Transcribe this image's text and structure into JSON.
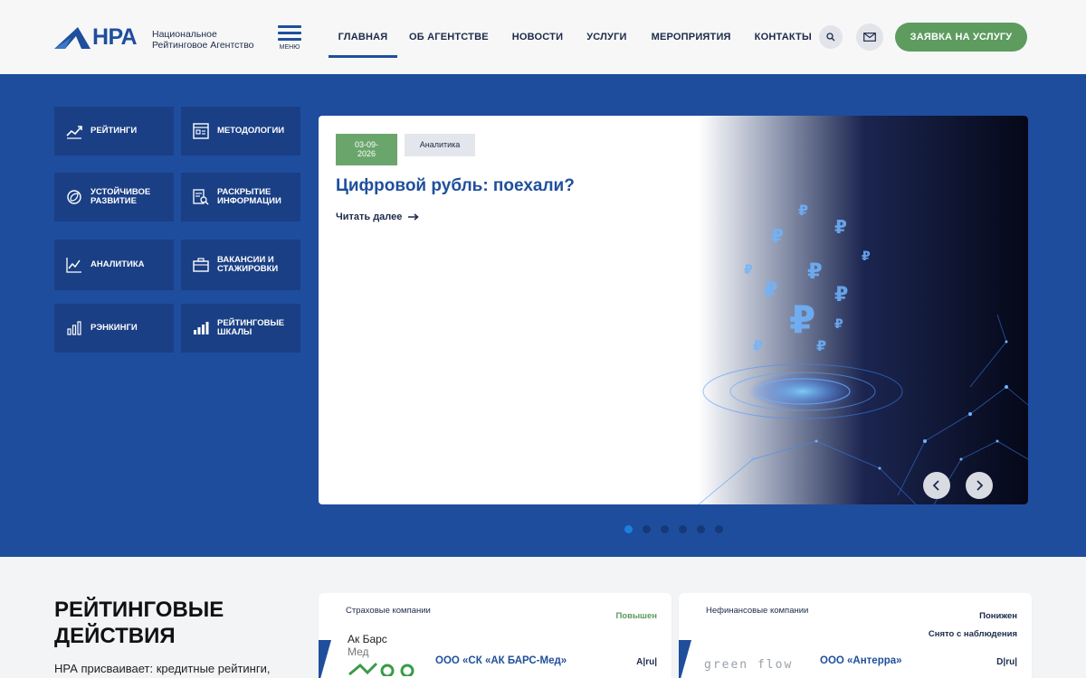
{
  "header": {
    "logo_text": "НРА",
    "logo_sub_line1": "Национальное",
    "logo_sub_line2": "Рейтинговое Агентство",
    "menu_label": "МЕНЮ",
    "nav": [
      {
        "label": "ГЛАВНАЯ",
        "active": true
      },
      {
        "label": "ОБ АГЕНТСТВЕ",
        "active": false
      },
      {
        "label": "НОВОСТИ",
        "active": false
      },
      {
        "label": "УСЛУГИ",
        "active": false
      },
      {
        "label": "МЕРОПРИЯТИЯ",
        "active": false
      },
      {
        "label": "КОНТАКТЫ",
        "active": false
      }
    ],
    "search_icon": "search-icon",
    "mail_icon": "mail-icon",
    "cta_label": "ЗАЯВКА НА УСЛУГУ"
  },
  "tiles": [
    {
      "line1": "РЕЙТИНГИ",
      "line2": "",
      "icon": "chart-up-icon"
    },
    {
      "line1": "МЕТОДОЛОГИИ",
      "line2": "",
      "icon": "methodology-icon"
    },
    {
      "line1": "УСТОЙЧИВОЕ",
      "line2": "РАЗВИТИЕ",
      "icon": "sustainability-icon"
    },
    {
      "line1": "РАСКРЫТИЕ",
      "line2": "ИНФОРМАЦИИ",
      "icon": "document-search-icon"
    },
    {
      "line1": "АНАЛИТИКА",
      "line2": "",
      "icon": "analytics-icon"
    },
    {
      "line1": "ВАКАНСИИ И",
      "line2": "СТАЖИРОВКИ",
      "icon": "briefcase-icon"
    },
    {
      "line1": "РЭНКИНГИ",
      "line2": "",
      "icon": "rankings-icon"
    },
    {
      "line1": "РЕЙТИНГОВЫЕ",
      "line2": "ШКАЛЫ",
      "icon": "scale-icon"
    }
  ],
  "slide": {
    "date_line1": "03-09-",
    "date_line2": "2026",
    "tag": "Аналитика",
    "title": "Цифровой рубль: поехали?",
    "read_more": "Читать далее",
    "active_dot": 0,
    "dot_count": 6
  },
  "ratings_section": {
    "title_line1": "РЕЙТИНГОВЫЕ",
    "title_line2": "ДЕЙСТВИЯ",
    "desc": "НРА присваивает: кредитные рейтинги, кредитные рейтинги надежности"
  },
  "cards": [
    {
      "category": "Страховые компании",
      "status1": "Повышен",
      "status2": "",
      "logo_line1": "Ак Барс",
      "logo_line2": "Мед",
      "company": "ООО «СК «АК БАРС-Мед»",
      "rating": "A|ru|"
    },
    {
      "category": "Нефинансовые компании",
      "status1": "Понижен",
      "status2": "Снято с наблюдения",
      "logo_line1": "green flow",
      "logo_line2": "",
      "company": "ООО «Антерра»",
      "rating": "D|ru|"
    }
  ],
  "colors": {
    "brand_blue": "#1f4f9c",
    "hero_bg": "#1e4d9e",
    "tile_bg": "#1a3f85",
    "green": "#5d9b5f",
    "down_text": "#1c2b4a"
  }
}
